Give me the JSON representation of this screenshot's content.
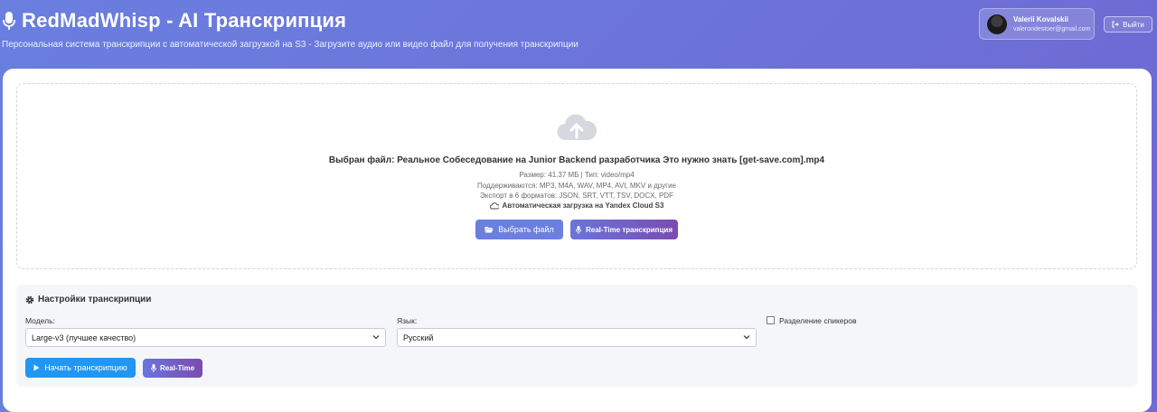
{
  "header": {
    "title": "RedMadWhisp - AI Транскрипция",
    "subtitle": "Персональная система транскрипции с автоматической загрузкой на S3 - Загрузите аудио или видео файл для получения транскрипции",
    "user": {
      "name": "Valerii Kovalskii",
      "email": "valerondestoer@gmail.com"
    },
    "logout_label": "Выйти"
  },
  "upload": {
    "selected_file": "Выбран файл: Реальное Собеседование на Junior Backend разработчика Это нужно знать [get-save.com].mp4",
    "file_info": "Размер: 41.37 МБ | Тип: video/mp4",
    "supported": "Поддерживаются: MP3, M4A, WAV, MP4, AVI, MKV и другие",
    "export": "Экспорт в 6 форматов: JSON, SRT, VTT, TSV, DOCX, PDF",
    "s3_note": "Автоматическая загрузка на Yandex Cloud S3",
    "choose_button": "Выбрать файл",
    "realtime_button": "Real-Time транскрипция"
  },
  "settings": {
    "title": "Настройки транскрипции",
    "model_label": "Модель:",
    "model_value": "Large-v3 (лучшее качество)",
    "language_label": "Язык:",
    "language_value": "Русский",
    "diarization_label": "Разделение спикеров",
    "diarization_checked": false,
    "start_button": "Начать транскрипцию",
    "realtime_button": "Real-Time"
  },
  "icons": {
    "title": "microphone-icon",
    "upload": "cloud-upload-icon",
    "settings": "gear-icon"
  },
  "colors": {
    "header_gradient_start": "#6a7fe0",
    "header_gradient_end": "#6f66d0",
    "primary": "#6a7fe0",
    "start_button": "#2196f3",
    "realtime_gradient_end": "#7a4bb0"
  }
}
